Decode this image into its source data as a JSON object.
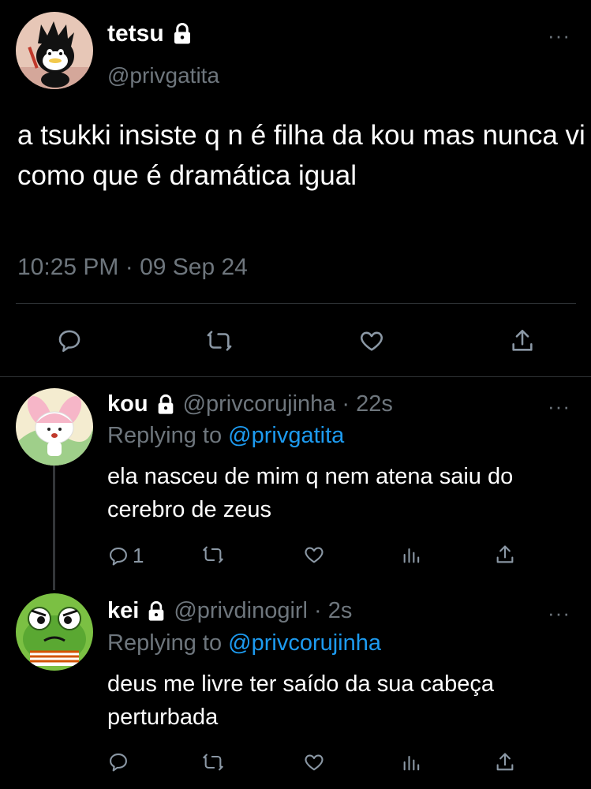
{
  "main_tweet": {
    "name": "tetsu",
    "handle": "@privgatita",
    "text": "a tsukki insiste q n é filha da kou mas nunca vi como que é dramática igual",
    "timestamp": "10:25 PM · 09 Sep 24",
    "more_label": "···",
    "avatar": "badtz-maru-avatar"
  },
  "replies": [
    {
      "name": "kou",
      "handle": "@privcorujinha",
      "time": "· 22s",
      "replying_prefix": "Replying to",
      "replying_to": "@privgatita",
      "text": "ela nasceu de mim q nem atena saiu do cerebro de zeus",
      "reply_count": "1",
      "avatar": "my-melody-avatar"
    },
    {
      "name": "kei",
      "handle": "@privdinogirl",
      "time": "· 2s",
      "replying_prefix": "Replying to",
      "replying_to": "@privcorujinha",
      "text": "deus me livre ter saído da sua cabeça perturbada",
      "reply_count": "",
      "avatar": "keroppi-avatar"
    }
  ],
  "colors": {
    "background": "#000000",
    "text": "#e7e9ea",
    "secondary": "#6e767d",
    "link": "#1d9bf0",
    "divider": "#2f3336"
  }
}
